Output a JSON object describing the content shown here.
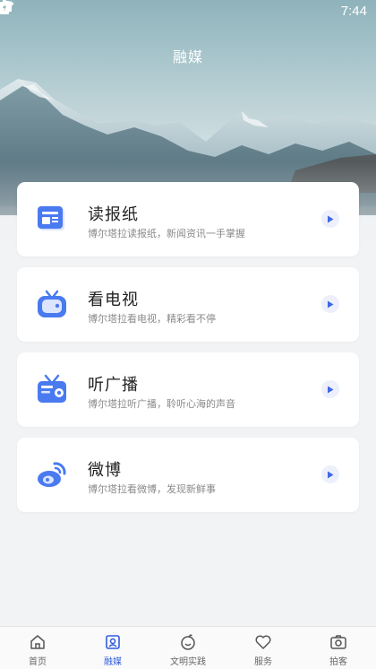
{
  "status_bar": {
    "time": "7:44"
  },
  "header": {
    "title": "融媒"
  },
  "cards": [
    {
      "title": "读报纸",
      "desc": "博尔塔拉读报纸，新闻资讯一手掌握",
      "icon": "newspaper-icon"
    },
    {
      "title": "看电视",
      "desc": "博尔塔拉看电视，精彩看不停",
      "icon": "tv-icon"
    },
    {
      "title": "听广播",
      "desc": "博尔塔拉听广播，聆听心海的声音",
      "icon": "radio-icon"
    },
    {
      "title": "微博",
      "desc": "博尔塔拉看微博，发现新鲜事",
      "icon": "weibo-icon"
    }
  ],
  "tabbar": {
    "items": [
      {
        "label": "首页",
        "icon": "home-icon"
      },
      {
        "label": "融媒",
        "icon": "media-icon",
        "active": true
      },
      {
        "label": "文明实践",
        "icon": "civilization-icon"
      },
      {
        "label": "服务",
        "icon": "heart-service-icon"
      },
      {
        "label": "拍客",
        "icon": "camera-icon"
      }
    ]
  },
  "colors": {
    "accent": "#2f5cdc",
    "icon_blue": "#4a7af0",
    "background": "#f2f3f5"
  }
}
